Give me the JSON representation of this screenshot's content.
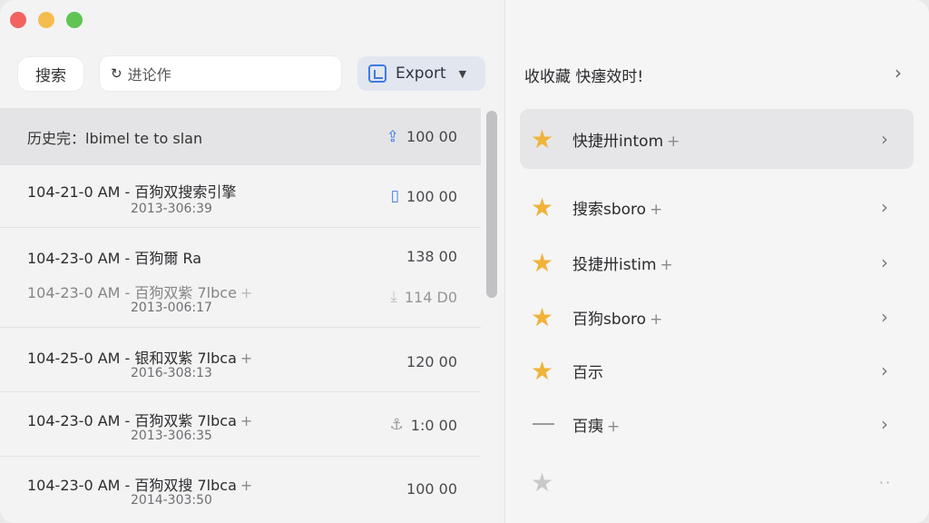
{
  "toolbar": {
    "search_button": "搜索",
    "search_value": "进论作",
    "export_label": "Export"
  },
  "history": {
    "header_label": "历史完：lbimel te to slan",
    "header_value": "100 00",
    "rows": [
      {
        "line": "104-21-0 AM - 百狗双搜索引擎",
        "sub": "2013-306:39",
        "value": "100 00",
        "icon": "document-icon"
      },
      {
        "line": "104-23-0 AM - 百狗爾 Ra",
        "sub": "",
        "value": "138 00",
        "icon": ""
      },
      {
        "line": "104-23-0 AM - 百狗双紫 7lbce",
        "sub": "2013-006:17",
        "value": "114 D0",
        "icon": "download-icon"
      },
      {
        "line": "104-25-0 AM - 银和双紫 7lbca",
        "sub": "2016-308:13",
        "value": "120 00",
        "icon": ""
      },
      {
        "line": "104-23-0 AM - 百狗双紫 7lbca",
        "sub": "2013-306:35",
        "value": "1:0 00",
        "icon": "anchor-icon"
      },
      {
        "line": "104-23-0 AM - 百狗双搜 7lbca",
        "sub": "2014-303:50",
        "value": "100 00",
        "icon": ""
      }
    ]
  },
  "favorites": {
    "title": "收收藏 快瘗效时!",
    "items": [
      {
        "label": "快捷卅intom",
        "icon": "star-icon"
      },
      {
        "label": "搜索sboro",
        "icon": "star-icon"
      },
      {
        "label": "投捷卅istim",
        "icon": "star-icon"
      },
      {
        "label": "百狗sboro",
        "icon": "star-icon"
      },
      {
        "label": "百示",
        "icon": "star-icon"
      },
      {
        "label": "百痍",
        "icon": "dash-icon"
      },
      {
        "label": "",
        "icon": "star-outline-icon"
      }
    ]
  }
}
